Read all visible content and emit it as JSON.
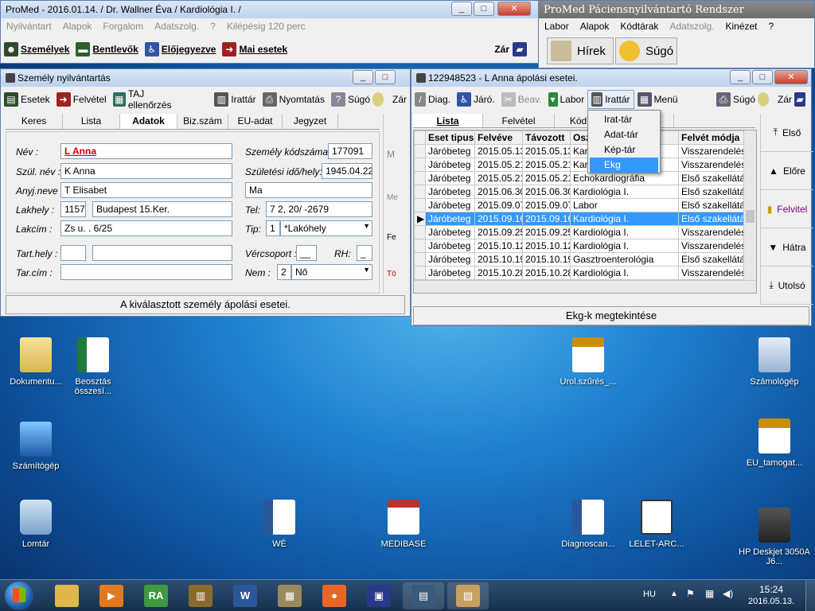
{
  "main_window": {
    "title": "ProMed - 2016.01.14. / Dr. Wallner Éva / Kardiológia I. /",
    "menu": [
      "Nyilvántart",
      "Alapok",
      "Forgalom",
      "Adatszolg.",
      "?",
      "Kilépésig 120 perc"
    ],
    "toolbar": {
      "szemelyek": "Személyek",
      "bentlevok": "Bentlevők",
      "elojegyezve": "Előjegyezve",
      "mai_esetek": "Mai esetek",
      "zar": "Zár"
    }
  },
  "right_window": {
    "title": "ProMed Páciensnyilvántartó Rendszer",
    "menu": [
      "Labor",
      "Alapok",
      "Kódtárak",
      "Adatszolg.",
      "Kinézet",
      "?"
    ],
    "hirek": "Hírek",
    "sugo": "Súgó"
  },
  "person_window": {
    "title": "Személy nyilvántartás",
    "toolbar": {
      "esetek": "Esetek",
      "felvetel": "Felvétel",
      "taj": "TAJ ellenőrzés",
      "irattar": "Irattár",
      "nyomtatas": "Nyomtatás",
      "sugo": "Súgó",
      "zar": "Zár"
    },
    "tabs": [
      "Keres",
      "Lista",
      "Adatok",
      "Biz.szám",
      "EU-adat",
      "Jegyzet"
    ],
    "active_tab": "Adatok",
    "labels": {
      "nev": "Név :",
      "szul_nev": "Szül. név :",
      "anyj_neve": "Anyj.neve :",
      "lakhely": "Lakhely :",
      "lakcim": "Lakcím :",
      "tart_hely": "Tart.hely :",
      "tar_cim": "Tar.cím :",
      "kodszam": "Személy kódszáma :",
      "szul_ido": "Születési idő/hely:",
      "tel": "Tel:",
      "tip": "Tip:",
      "vercsoport": "Vércsoport :",
      "rh": "RH:",
      "nem": "Nem :"
    },
    "values": {
      "nev": "L           Anna",
      "szul_nev": "K      Anna",
      "anyj_neve": "T              Elisabet",
      "irsz": "1157",
      "lakhely": "Budapest 15.Ker.",
      "lakcim": "Zs           u.     . 6/25",
      "kodszam": "177091",
      "szul_ido": "1945.04.22",
      "szul_hely": "Ma",
      "tel": "7           2, 20/       -2679",
      "tip_code": "1",
      "tip_value": "*Lakóhely",
      "vercsoport": "__",
      "rh": "_",
      "nem_code": "2",
      "nem_value": "Nő"
    },
    "side_buttons": [
      "M",
      "Me",
      "Fe",
      "Tö"
    ],
    "status": "A kiválasztott személy ápolási esetei."
  },
  "care_window": {
    "title": "122948523 - L          Anna ápolási esetei.",
    "toolbar": {
      "diag": "Diag.",
      "jaro": "Járó.",
      "beav": "Beav.",
      "labor": "Labor",
      "irattar": "Irattár",
      "menu": "Menü",
      "sugo": "Súgó",
      "zar": "Zár"
    },
    "tabs": [
      "Lista",
      "Felvétel",
      "Kód",
      "tás"
    ],
    "columns": [
      "Eset tipus",
      "Felvéve",
      "Távozott",
      "Osz",
      "Felvét módja"
    ],
    "rows": [
      [
        "Járóbeteg",
        "2015.05.13",
        "2015.05.13",
        "Kard",
        "Visszarendelés"
      ],
      [
        "Járóbeteg",
        "2015.05.21",
        "2015.05.21",
        "Kard",
        "Visszarendelés"
      ],
      [
        "Járóbeteg",
        "2015.05.21",
        "2015.05.21",
        "Echokardiográfia",
        "Első szakellátás a"
      ],
      [
        "Járóbeteg",
        "2015.06.30",
        "2015.06.30",
        "Kardiológia I.",
        "Első szakellátás a"
      ],
      [
        "Járóbeteg",
        "2015.09.07",
        "2015.09.07",
        "Labor",
        "Első szakellátás a"
      ],
      [
        "Járóbeteg",
        "2015.09.16",
        "2015.09.16",
        "Kardiológia I.",
        "Első szakellátás a"
      ],
      [
        "Járóbeteg",
        "2015.09.25",
        "2015.09.25",
        "Kardiológia I.",
        "Visszarendelés"
      ],
      [
        "Járóbeteg",
        "2015.10.12",
        "2015.10.12",
        "Kardiológia I.",
        "Visszarendelés"
      ],
      [
        "Járóbeteg",
        "2015.10.19",
        "2015.10.19",
        "Gasztroenterológia",
        "Első szakellátás a"
      ],
      [
        "Járóbeteg",
        "2015.10.28",
        "2015.10.28",
        "Kardiológia I.",
        "Visszarendelés"
      ]
    ],
    "selected_row": 5,
    "nav_buttons": [
      "Első",
      "Előre",
      "Felvitel",
      "Hátra",
      "Utolsó"
    ],
    "status": "Ekg-k megtekintése"
  },
  "popup_menu": {
    "items": [
      "Irat-tár",
      "Adat-tár",
      "Kép-tár",
      "Ekg"
    ],
    "highlighted": 3
  },
  "desktop_icons": [
    {
      "label": "Dokumentu...",
      "type": "folder"
    },
    {
      "label": "Beosztás összesí...",
      "type": "excel"
    },
    {
      "label": "Számítógép",
      "type": "computer"
    },
    {
      "label": "Lomtár",
      "type": "recycle"
    },
    {
      "label": "WÉ",
      "type": "word"
    },
    {
      "label": "MEDIBASE",
      "type": "medibase"
    },
    {
      "label": "Urol.szűrés_...",
      "type": "pdf"
    },
    {
      "label": "Diagnoscan...",
      "type": "word"
    },
    {
      "label": "LELET-ARC...",
      "type": "lelet"
    },
    {
      "label": "Számológép",
      "type": "calc"
    },
    {
      "label": "EU_tamogat...",
      "type": "pdf"
    },
    {
      "label": "HP Deskjet 3050A J6...",
      "type": "printer"
    }
  ],
  "taskbar": {
    "lang": "HU",
    "time": "15:24",
    "date": "2016.05.13.",
    "apps": [
      "folder",
      "media",
      "RA",
      "app",
      "W",
      "app2",
      "firefox",
      "save",
      "app3",
      "app4"
    ]
  },
  "colors": {
    "selection": "#3399ff",
    "name_red": "#cc0000",
    "title_active": "#bcd2ee"
  }
}
